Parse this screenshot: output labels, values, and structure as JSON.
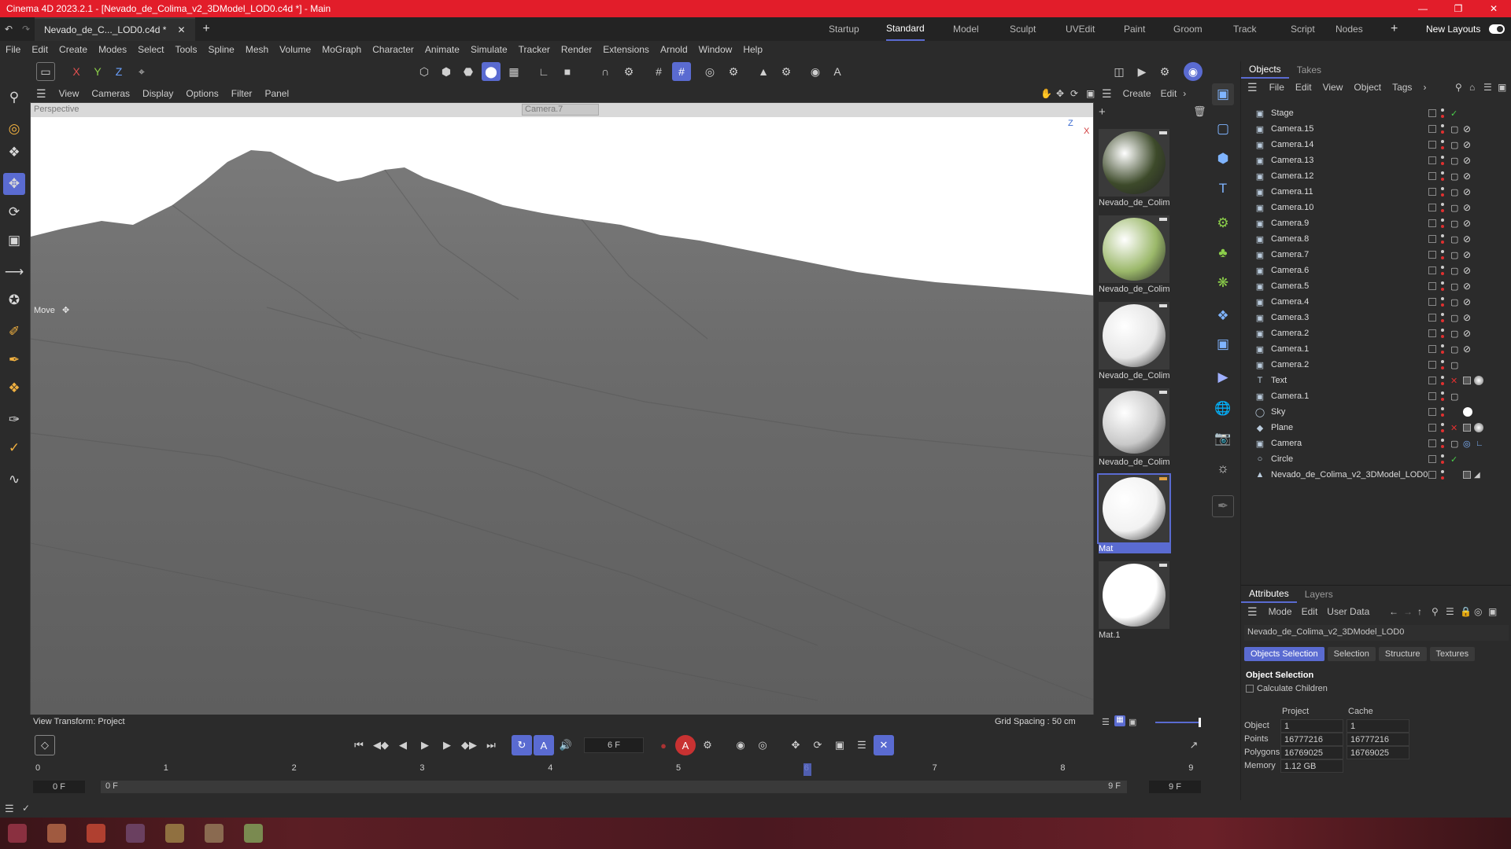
{
  "title": "Cinema 4D 2023.2.1 - [Nevado_de_Colima_v2_3DModel_LOD0.c4d *] - Main",
  "doc_tab": "Nevado_de_C..._LOD0.c4d *",
  "layouts": [
    "Startup",
    "Standard",
    "Model",
    "Sculpt",
    "UVEdit",
    "Paint",
    "Groom",
    "Track",
    "Script",
    "Nodes"
  ],
  "active_layout": "Standard",
  "new_layouts": "New Layouts",
  "menu": [
    "File",
    "Edit",
    "Create",
    "Modes",
    "Select",
    "Tools",
    "Spline",
    "Mesh",
    "Volume",
    "MoGraph",
    "Character",
    "Animate",
    "Simulate",
    "Tracker",
    "Render",
    "Extensions",
    "Arnold",
    "Window",
    "Help"
  ],
  "axes": {
    "x": "X",
    "y": "Y",
    "z": "Z"
  },
  "viewport": {
    "menu": [
      "View",
      "Cameras",
      "Display",
      "Options",
      "Filter",
      "Panel"
    ],
    "projection": "Perspective",
    "camera": "Camera.7",
    "tool_label": "Move",
    "view_transform": "View Transform: Project",
    "grid_spacing": "Grid Spacing : 50 cm",
    "axis_z": "Z",
    "axis_x": "X"
  },
  "materials": {
    "menu": [
      "Create",
      "Edit"
    ],
    "items": [
      {
        "name": "Nevado_de_Colim",
        "color": "#3d4a2a"
      },
      {
        "name": "Nevado_de_Colim",
        "color": "#9bb86a"
      },
      {
        "name": "Nevado_de_Colim",
        "color": "#e6e6e6"
      },
      {
        "name": "Nevado_de_Colim",
        "color": "#c9c9c9"
      },
      {
        "name": "Mat",
        "color": "#f2f2f2"
      },
      {
        "name": "Mat.1",
        "color": "#ffffff"
      }
    ],
    "selected_index": 4
  },
  "objects_panel": {
    "tabs": [
      "Objects",
      "Takes"
    ],
    "menu": [
      "File",
      "Edit",
      "View",
      "Object",
      "Tags"
    ],
    "items": [
      {
        "name": "Stage",
        "icon": "stage-icon"
      },
      {
        "name": "Camera.15",
        "icon": "camera-icon"
      },
      {
        "name": "Camera.14",
        "icon": "camera-icon"
      },
      {
        "name": "Camera.13",
        "icon": "camera-icon"
      },
      {
        "name": "Camera.12",
        "icon": "camera-icon"
      },
      {
        "name": "Camera.11",
        "icon": "camera-icon"
      },
      {
        "name": "Camera.10",
        "icon": "camera-icon"
      },
      {
        "name": "Camera.9",
        "icon": "camera-icon"
      },
      {
        "name": "Camera.8",
        "icon": "camera-icon"
      },
      {
        "name": "Camera.7",
        "icon": "camera-icon"
      },
      {
        "name": "Camera.6",
        "icon": "camera-icon"
      },
      {
        "name": "Camera.5",
        "icon": "camera-icon"
      },
      {
        "name": "Camera.4",
        "icon": "camera-icon"
      },
      {
        "name": "Camera.3",
        "icon": "camera-icon"
      },
      {
        "name": "Camera.2",
        "icon": "camera-icon"
      },
      {
        "name": "Camera.1",
        "icon": "camera-icon"
      },
      {
        "name": "Camera.2",
        "icon": "camera-icon"
      },
      {
        "name": "Text",
        "icon": "text-icon"
      },
      {
        "name": "Camera.1",
        "icon": "camera-icon"
      },
      {
        "name": "Sky",
        "icon": "sky-icon"
      },
      {
        "name": "Plane",
        "icon": "plane-icon"
      },
      {
        "name": "Camera",
        "icon": "camera-icon"
      },
      {
        "name": "Circle",
        "icon": "circle-icon"
      },
      {
        "name": "Nevado_de_Colima_v2_3DModel_LOD0",
        "icon": "polygon-object-icon"
      }
    ]
  },
  "attributes": {
    "tabs": [
      "Attributes",
      "Layers"
    ],
    "menu": [
      "Mode",
      "Edit",
      "User Data"
    ],
    "object_name": "Nevado_de_Colima_v2_3DModel_LOD0",
    "subtabs": [
      "Objects Selection",
      "Selection",
      "Structure",
      "Textures"
    ],
    "section": "Object Selection",
    "calculate_children": "Calculate Children",
    "col_project": "Project",
    "col_cache": "Cache",
    "rows": [
      {
        "label": "Object",
        "project": "1",
        "cache": "1"
      },
      {
        "label": "Points",
        "project": "16777216",
        "cache": "16777216"
      },
      {
        "label": "Polygons",
        "project": "16769025",
        "cache": "16769025"
      },
      {
        "label": "Memory",
        "project": "1.12 GB",
        "cache": ""
      }
    ]
  },
  "timeline": {
    "current_frame": "6 F",
    "ticks": [
      "0",
      "1",
      "2",
      "3",
      "4",
      "5",
      "6",
      "7",
      "8",
      "9"
    ],
    "start": "0 F",
    "range_start": "0 F",
    "range_end": "9 F",
    "end": "9 F",
    "playhead_frame": 6
  },
  "colors": {
    "accent": "#5a6bd1",
    "titlebar": "#e21d2a"
  }
}
